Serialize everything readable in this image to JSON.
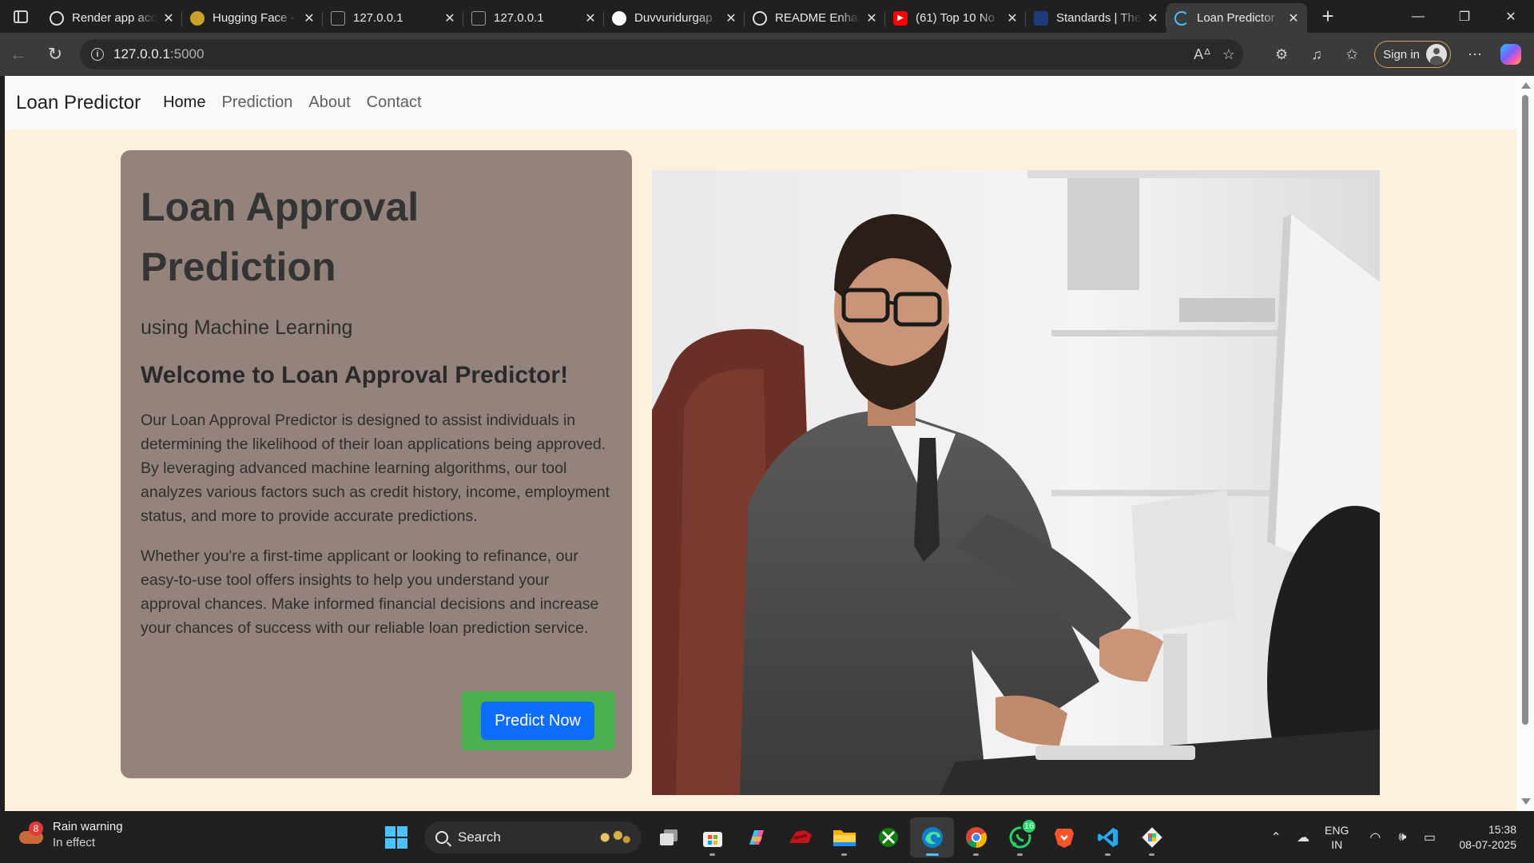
{
  "browser": {
    "tabs": [
      {
        "title": "Render app acc",
        "icon": "openai-icon",
        "color": "#202020"
      },
      {
        "title": "Hugging Face -",
        "icon": "hugging-face-icon",
        "color": "#ffcc4d"
      },
      {
        "title": "127.0.0.1",
        "icon": "page-icon",
        "color": "#5a5a5a"
      },
      {
        "title": "127.0.0.1",
        "icon": "page-icon",
        "color": "#5a5a5a"
      },
      {
        "title": "Duvvuridurgap",
        "icon": "github-icon",
        "color": "#ffffff"
      },
      {
        "title": "README Enhan",
        "icon": "openai-icon",
        "color": "#202020"
      },
      {
        "title": "(61) Top 10 No",
        "icon": "youtube-icon",
        "color": "#ff0000"
      },
      {
        "title": "Standards | The",
        "icon": "site-icon",
        "color": "#1d3c7a"
      },
      {
        "title": "Loan Predictor",
        "icon": "loading-icon",
        "color": "#4cc2ff",
        "active": true
      }
    ],
    "url_host": "127.0.0.1",
    "url_port": ":5000",
    "signin_label": "Sign in"
  },
  "site": {
    "brand": "Loan Predictor",
    "nav": [
      "Home",
      "Prediction",
      "About",
      "Contact"
    ],
    "active_nav": "Home"
  },
  "hero": {
    "title": "Loan Approval Prediction",
    "subtitle": "using Machine Learning",
    "welcome": "Welcome to Loan Approval Predictor!",
    "paragraph1": "Our Loan Approval Predictor is designed to assist individuals in determining the likelihood of their loan applications being approved. By leveraging advanced machine learning algorithms, our tool analyzes various factors such as credit history, income, employment status, and more to provide accurate predictions.",
    "paragraph2": "Whether you're a first-time applicant or looking to refinance, our easy-to-use tool offers insights to help you understand your approval chances. Make informed financial decisions and increase your chances of success with our reliable loan prediction service.",
    "cta_label": "Predict Now"
  },
  "taskbar": {
    "weather_title": "Rain warning",
    "weather_sub": "In effect",
    "weather_badge": "8",
    "search_label": "Search",
    "whatsapp_count": "16",
    "lang_line1": "ENG",
    "lang_line2": "IN",
    "time": "15:38",
    "date": "08-07-2025"
  },
  "colors": {
    "page_bg": "#fdf0dc",
    "card_bg": "#94837c",
    "cta_bg": "#0d6efd",
    "cta_wrap_bg": "#4caf50"
  }
}
